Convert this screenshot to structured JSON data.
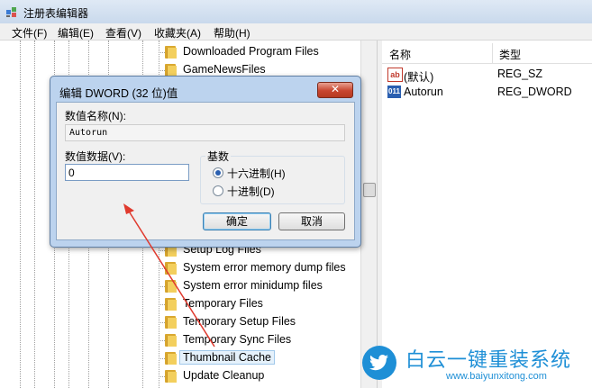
{
  "window": {
    "title": "注册表编辑器"
  },
  "menu": [
    "文件(F)",
    "编辑(E)",
    "查看(V)",
    "收藏夹(A)",
    "帮助(H)"
  ],
  "tree": {
    "items": [
      {
        "label": "Downloaded Program Files"
      },
      {
        "label": "GameNewsFiles"
      },
      {
        "label": "Setup Log Files"
      },
      {
        "label": "System error memory dump files"
      },
      {
        "label": "System error minidump files"
      },
      {
        "label": "Temporary Files"
      },
      {
        "label": "Temporary Setup Files"
      },
      {
        "label": "Temporary Sync Files"
      },
      {
        "label": "Thumbnail Cache",
        "selected": true
      },
      {
        "label": "Update Cleanup"
      }
    ]
  },
  "values_pane": {
    "col_name": "名称",
    "col_type": "类型",
    "rows": [
      {
        "icon": "string-value-icon",
        "icon_text": "ab",
        "name": "(默认)",
        "type": "REG_SZ"
      },
      {
        "icon": "binary-value-icon",
        "icon_text": "011",
        "name": "Autorun",
        "type": "REG_DWORD"
      }
    ]
  },
  "dialog": {
    "title": "编辑 DWORD (32 位)值",
    "name_label": "数值名称(N):",
    "name_value": "Autorun",
    "data_label": "数值数据(V):",
    "data_value": "0",
    "base_label": "基数",
    "hex_label": "十六进制(H)",
    "dec_label": "十进制(D)",
    "selected_base": "hex",
    "ok_label": "确定",
    "cancel_label": "取消"
  },
  "watermark": {
    "brand": "白云一键重装系统",
    "url": "www.baiyunxitong.com"
  },
  "colors": {
    "annotation_arrow": "#e03a2e",
    "brand": "#1e8fd6",
    "dialog_frame": "#bcd3ee"
  }
}
